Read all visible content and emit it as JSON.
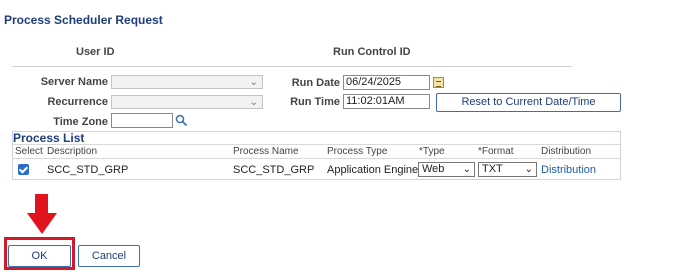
{
  "page": {
    "title": "Process Scheduler Request"
  },
  "header": {
    "user_id_label": "User ID",
    "run_control_label": "Run Control ID"
  },
  "form": {
    "server_name_label": "Server Name",
    "recurrence_label": "Recurrence",
    "time_zone_label": "Time Zone",
    "run_date_label": "Run Date",
    "run_date_value": "06/24/2025",
    "run_time_label": "Run Time",
    "run_time_value": "11:02:01AM",
    "reset_button": "Reset to Current Date/Time"
  },
  "process_list": {
    "title": "Process List",
    "columns": [
      "Select",
      "Description",
      "Process Name",
      "Process Type",
      "*Type",
      "*Format",
      "Distribution"
    ],
    "rows": [
      {
        "selected": true,
        "description": "SCC_STD_GRP",
        "process_name": "SCC_STD_GRP",
        "process_type": "Application Engine",
        "type": "Web",
        "format": "TXT",
        "distribution": "Distribution"
      }
    ]
  },
  "buttons": {
    "ok": "OK",
    "cancel": "Cancel"
  },
  "colors": {
    "title": "#1f3d7a",
    "link": "#1f5fa8",
    "annotation": "#e0131f",
    "checkbox": "#2a6fc9"
  }
}
